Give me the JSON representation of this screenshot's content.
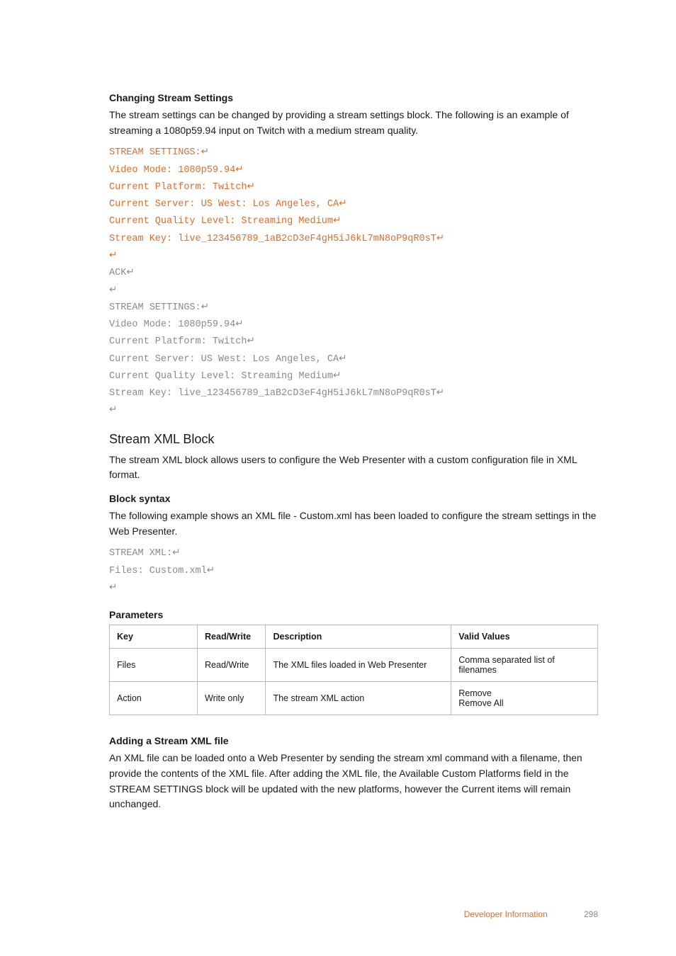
{
  "section1": {
    "heading": "Changing Stream Settings",
    "para": "The stream settings can be changed by providing a stream settings block. The following is an example of streaming a 1080p59.94 input on Twitch with a medium stream quality."
  },
  "return_glyph": "↵",
  "code1_orange": [
    "STREAM SETTINGS:",
    "Video Mode: 1080p59.94",
    "Current Platform: Twitch",
    "Current Server: US West: Los Angeles, CA",
    "Current Quality Level: Streaming Medium",
    "Stream Key: live_123456789_1aB2cD3eF4gH5iJ6kL7mN8oP9qR0sT",
    ""
  ],
  "code1_gray": [
    "ACK",
    "",
    "STREAM SETTINGS:",
    "Video Mode: 1080p59.94",
    "Current Platform: Twitch",
    "Current Server: US West: Los Angeles, CA",
    "Current Quality Level: Streaming Medium",
    "Stream Key: live_123456789_1aB2cD3eF4gH5iJ6kL7mN8oP9qR0sT",
    ""
  ],
  "section2": {
    "heading": "Stream XML Block",
    "para": "The stream XML block allows users to configure the Web Presenter with a custom configuration file in XML format."
  },
  "section3": {
    "heading": "Block syntax",
    "para": "The following example shows an XML file - Custom.xml has been loaded to configure the stream settings in the Web Presenter."
  },
  "code2": [
    "STREAM XML:",
    "Files: Custom.xml",
    ""
  ],
  "params_heading": "Parameters",
  "table": {
    "headers": [
      "Key",
      "Read/Write",
      "Description",
      "Valid Values"
    ],
    "rows": [
      [
        "Files",
        "Read/Write",
        "The XML files loaded in Web Presenter",
        "Comma separated list of filenames"
      ],
      [
        "Action",
        "Write only",
        "The stream XML action",
        "Remove\nRemove All"
      ]
    ]
  },
  "section4": {
    "heading": "Adding a Stream XML file",
    "para": "An XML file can be loaded onto a Web Presenter by sending the stream xml command with a filename, then provide the contents of the XML file. After adding the XML file, the Available Custom Platforms field in the STREAM SETTINGS block will be updated with the new platforms, however the Current items will remain unchanged."
  },
  "footer": {
    "section": "Developer Information",
    "page": "298"
  }
}
